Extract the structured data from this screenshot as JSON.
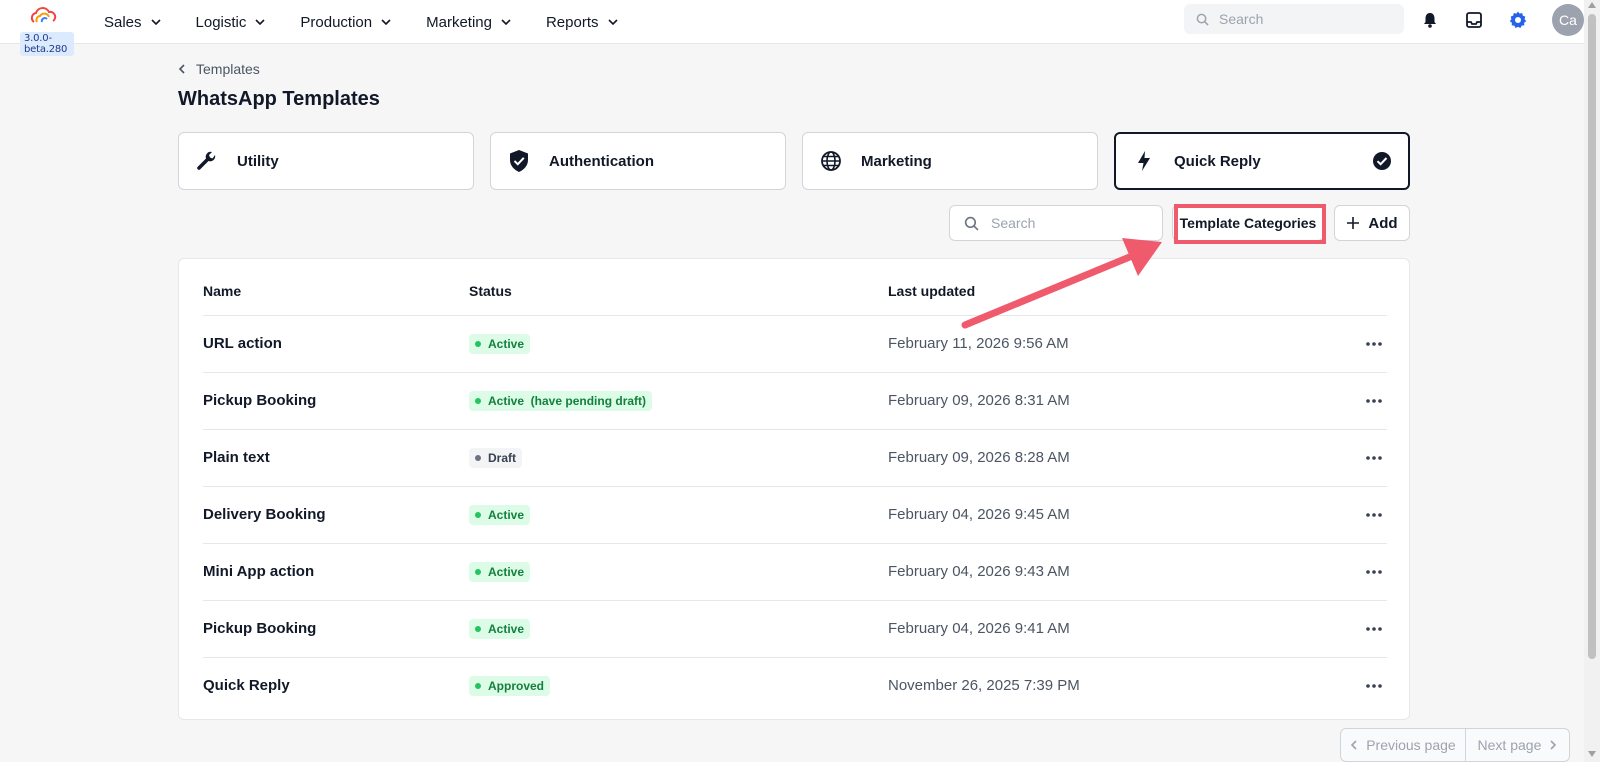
{
  "app": {
    "version": "3.0.0-beta.280"
  },
  "nav": {
    "items": [
      {
        "label": "Sales"
      },
      {
        "label": "Logistic"
      },
      {
        "label": "Production"
      },
      {
        "label": "Marketing"
      },
      {
        "label": "Reports"
      }
    ],
    "search_placeholder": "Search",
    "avatar_initials": "Ca"
  },
  "breadcrumb": {
    "label": "Templates"
  },
  "page": {
    "title": "WhatsApp Templates"
  },
  "categories": [
    {
      "label": "Utility",
      "icon": "wrench-icon",
      "selected": false
    },
    {
      "label": "Authentication",
      "icon": "shield-check-icon",
      "selected": false
    },
    {
      "label": "Marketing",
      "icon": "globe-icon",
      "selected": false
    },
    {
      "label": "Quick Reply",
      "icon": "bolt-icon",
      "selected": true
    }
  ],
  "toolbar": {
    "search_placeholder": "Search",
    "template_categories_label": "Template Categories",
    "add_label": "Add"
  },
  "table": {
    "headers": {
      "name": "Name",
      "status": "Status",
      "last_updated": "Last updated"
    },
    "rows": [
      {
        "name": "URL action",
        "status": "Active",
        "date": "February 11, 2026 9:56 AM"
      },
      {
        "name": "Pickup Booking",
        "status": "Active  (have pending draft)",
        "date": "February 09, 2026 8:31 AM"
      },
      {
        "name": "Plain text",
        "status": "Draft",
        "date": "February 09, 2026 8:28 AM"
      },
      {
        "name": "Delivery Booking",
        "status": "Active",
        "date": "February 04, 2026 9:45 AM"
      },
      {
        "name": "Mini App action",
        "status": "Active",
        "date": "February 04, 2026 9:43 AM"
      },
      {
        "name": "Pickup Booking",
        "status": "Active",
        "date": "February 04, 2026 9:41 AM"
      },
      {
        "name": "Quick Reply",
        "status": "Approved",
        "date": "November 26, 2025 7:39 PM"
      }
    ]
  },
  "pagination": {
    "prev_label": "Previous page",
    "next_label": "Next page"
  },
  "colors": {
    "highlight": "#ef5b6c",
    "active_badge_bg": "#dcfce7",
    "active_badge_text": "#15803d",
    "settings_accent": "#2563eb"
  }
}
